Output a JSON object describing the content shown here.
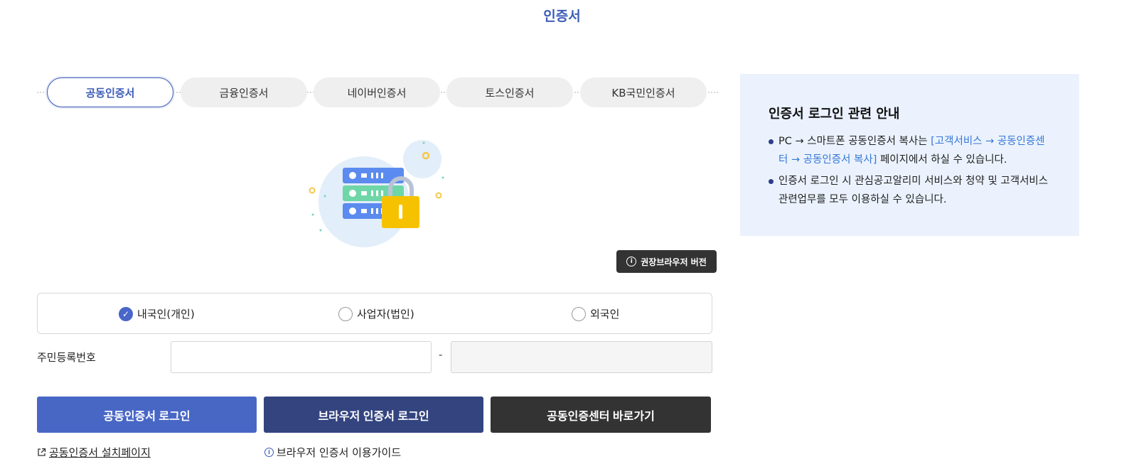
{
  "page": {
    "title": "인증서"
  },
  "tabs": [
    {
      "label": "공동인증서",
      "active": true
    },
    {
      "label": "금융인증서",
      "active": false
    },
    {
      "label": "네이버인증서",
      "active": false
    },
    {
      "label": "토스인증서",
      "active": false
    },
    {
      "label": "KB국민인증서",
      "active": false
    }
  ],
  "browser_version_button": {
    "label": "권장브라우저 버전",
    "icon": "info-icon"
  },
  "user_type": {
    "options": [
      {
        "label": "내국인(개인)",
        "checked": true
      },
      {
        "label": "사업자(법인)",
        "checked": false
      },
      {
        "label": "외국인",
        "checked": false
      }
    ]
  },
  "rrn": {
    "label": "주민등록번호",
    "value1": "",
    "value2": "",
    "separator": "-"
  },
  "buttons": {
    "cert_login": "공동인증서 로그인",
    "browser_cert_login": "브라우저 인증서 로그인",
    "cert_center": "공동인증센터 바로가기"
  },
  "links": {
    "install_page": "공동인증서 설치페이지",
    "browser_guide": "브라우저 인증서 이용가이드"
  },
  "notice": {
    "title": "인증서 로그인 관련 안내",
    "item1_prefix": "PC → 스마트폰 공동인증서 복사는 ",
    "item1_link": "[고객서비스 → 공동인증센터 → 공동인증서 복사]",
    "item1_suffix": " 페이지에서 하실 수 있습니다.",
    "item2": "인증서 로그인 시 관심공고알리미 서비스와 청약 및 고객서비스 관련업무를 모두 이용하실 수 있습니다."
  },
  "colors": {
    "accent": "#3d5cb8",
    "btn_primary": "#4867c5",
    "btn_navy": "#33447f",
    "btn_dark": "#333333",
    "notice_bg": "#ebf2fd"
  }
}
